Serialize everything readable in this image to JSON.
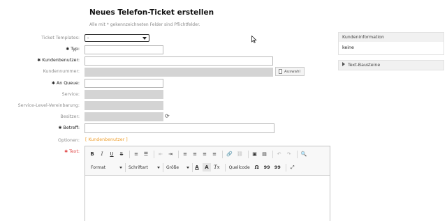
{
  "page": {
    "title": "Neues Telefon-Ticket erstellen",
    "hint": "Alle mit * gekennzeichneten Felder sind Pflichtfelder."
  },
  "form": {
    "ticket_templates": {
      "label": "Ticket Templates:",
      "value": "-"
    },
    "typ": {
      "label": "Typ:",
      "required": true
    },
    "kundenbenutzer": {
      "label": "Kundenbenutzer:",
      "required": true
    },
    "kundennummer": {
      "label": "Kundennummer:",
      "button": "Auswahl"
    },
    "an_queue": {
      "label": "An Queue:",
      "required": true
    },
    "service": {
      "label": "Service:"
    },
    "sla": {
      "label": "Service-Level-Vereinbarung:"
    },
    "besitzer": {
      "label": "Besitzer:"
    },
    "betreff": {
      "label": "Betreff:",
      "required": true
    },
    "optionen": {
      "label": "Optionen:",
      "link": "[ Kundenbenutzer ]"
    },
    "text": {
      "label": "Text:",
      "required": true
    }
  },
  "editor": {
    "row1": [
      "B",
      "I",
      "U",
      "S",
      "≡",
      "☰",
      "⇤",
      "⇥",
      "≡",
      "≡",
      "≡",
      "≡",
      "🔗",
      "⛓",
      "▣",
      "▤",
      "↶",
      "↷",
      "🔍"
    ],
    "row2": {
      "format": "Format",
      "font": "Schriftart",
      "size": "Größe",
      "text_color": "A",
      "bg_color": "A",
      "clear_format": "Tx",
      "source": "Quellcode",
      "omega": "Ω",
      "quote_open": "99",
      "quote_close": "99",
      "maximize": "⤢"
    }
  },
  "sidebar": {
    "customer_info": {
      "title": "Kundeninformation",
      "value": "keine"
    },
    "text_modules": {
      "title": "Text-Bausteine"
    }
  },
  "colors": {
    "required_error": "#e14a4a",
    "link": "#f0a030",
    "disabled_field": "#d4d4d4"
  }
}
